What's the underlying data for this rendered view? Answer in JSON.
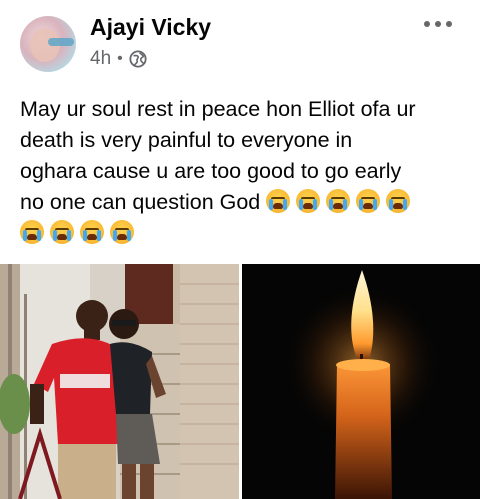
{
  "post": {
    "author": "Ajayi Vicky",
    "time": "4h",
    "separator": "•",
    "audience_icon": "globe-icon",
    "more_icon": "more-horizontal-icon",
    "text_line1": "May ur soul rest in peace hon Elliot ofa ur",
    "text_line2": "death is very painful to everyone in",
    "text_line3": "oghara cause u are too good to go early",
    "text_line4": "no one can question God",
    "emoji_icon": "loudly-crying-face-emoji"
  },
  "photos": {
    "left_alt": "photo-couple",
    "right_alt": "photo-candle"
  },
  "colors": {
    "text": "#050505",
    "secondary": "#65676b",
    "background": "#ffffff"
  }
}
